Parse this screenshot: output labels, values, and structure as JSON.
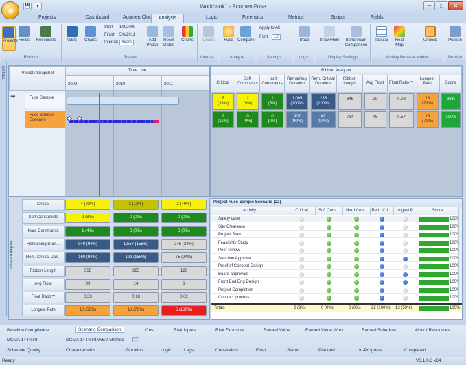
{
  "window": {
    "title": "Workbook1 - Acumen Fuse",
    "min": "─",
    "max": "□",
    "close": "✕"
  },
  "qat": [
    "💾",
    "▾"
  ],
  "tabs": [
    "Projects",
    "Dashboard",
    "Acumen Cloud™",
    "Analysis",
    "Logic",
    "Forensics",
    "Metrics",
    "Scripts",
    "Fields"
  ],
  "active_tab": "Analysis",
  "ribbon": {
    "groups": [
      "Ribbons",
      "Phases",
      "Interse...",
      "Analyze",
      "Settings",
      "Logic",
      "Display Settings",
      "Activity Browser Modes",
      "Publish"
    ],
    "buttons": {
      "projects": "Projects",
      "fields": "Fields",
      "resources": "Resources",
      "wbs": "WBS",
      "charts": "Charts",
      "add_phase": "Add Phase",
      "reset_dates": "Reset Dates",
      "charts2": "Charts",
      "charts3": "Charts",
      "fuse": "Fuse",
      "compare": "Compare",
      "trace": "Trace",
      "show_hide": "Show/Hide",
      "benchmark": "Benchmark Comparison",
      "tabular": "Tabular",
      "heat_map": "Heat Map",
      "undock": "Undock",
      "publish": "Publish"
    },
    "start_label": "Start",
    "start_value": "1/8/2009",
    "finish_label": "Finish",
    "finish_value": "5/6/2011",
    "interval_label": "Interval",
    "interval_value": "Years",
    "apply_all": "Apply to All",
    "font_label": "Font",
    "font_value": "12"
  },
  "side_label": "Metrics",
  "timeline": {
    "header_project": "Project / Snapshot",
    "header_timeline": "Time Line",
    "years": [
      "2009",
      "2010",
      "2011"
    ],
    "projects": [
      {
        "name": "Fuse Sample"
      },
      {
        "name": "Fuse Sample Scenario"
      }
    ]
  },
  "ribbon_analyzer": {
    "title": "Ribbon Analyzer",
    "columns": [
      "Critical",
      "Soft Constraints",
      "Hard Constraints",
      "Remaining Duration",
      "Rem. Critical Duration",
      "Ribbon Length",
      "Avg Float",
      "Float Ratio™",
      "Longest Path",
      "Score"
    ],
    "rows": [
      [
        "6\n(33%)",
        "2\n(9%)",
        "1\n(5%)",
        "1,005\n(100%)",
        "235\n(100%)",
        "848",
        "29",
        "0.08",
        "13\n(72%)",
        "86%"
      ],
      [
        "2\n(11%)",
        "0\n(0%)",
        "0\n(0%)",
        "907\n(90%)",
        "49\n(90%)",
        "714",
        "48",
        "0.57",
        "13\n(72%)",
        "100%"
      ]
    ]
  },
  "phase_analyzer": {
    "label": "Phase Analyzer",
    "rows": [
      {
        "name": "Critical",
        "values": [
          "4 (22%)",
          "3 (13%)",
          "2 (40%)"
        ]
      },
      {
        "name": "Soft Constraints",
        "values": [
          "2 (8%)",
          "0 (0%)",
          "0 (0%)"
        ]
      },
      {
        "name": "Hard Constraints",
        "values": [
          "1 (4%)",
          "0 (0%)",
          "0 (0%)"
        ]
      },
      {
        "name": "Remaining Durs...",
        "values": [
          "940 (94%)",
          "1,557 (155%)",
          "245 (24%)"
        ]
      },
      {
        "name": "Rem. Critical Dur...",
        "values": [
          "160 (94%)",
          "129 (155%)",
          "75 (24%)"
        ]
      },
      {
        "name": "Ribbon Length",
        "values": [
          "358",
          "365",
          "126"
        ]
      },
      {
        "name": "Avg Float",
        "values": [
          "99",
          "14",
          "1"
        ]
      },
      {
        "name": "Float Ratio™",
        "values": [
          "0.33",
          "0.18",
          "0.02"
        ]
      },
      {
        "name": "Longest Path",
        "values": [
          "10 (56%)",
          "18 (78%)",
          "5 (100%)"
        ]
      }
    ]
  },
  "project_panel": {
    "title": "Project Fuse Sample Scenario (22)",
    "columns": [
      "Activity",
      "Critical",
      "Soft Cons...",
      "Hard Con...",
      "Rem. Crit...",
      "Longest P...",
      "Score"
    ],
    "rows": [
      "Safety case",
      "Site Clearance",
      "Project Start",
      "Feasibility Study",
      "Peer review",
      "Sanction Approval",
      "Proof of Concept Design",
      "Board approvals",
      "Front End Eng Design",
      "Project Completion",
      "Contract process"
    ],
    "row_score": "100%",
    "totals": {
      "label": "Totals",
      "critical": "2 (9%)",
      "soft": "0 (0%)",
      "hard": "0 (0%)",
      "rem": "22 (100%)",
      "longest": "13 (59%)",
      "score": "100%"
    }
  },
  "bottom_tabs": {
    "row1": [
      "Baseline Compliance",
      "Scenario Comparison",
      "Cost",
      "Risk Inputs",
      "Risk Exposure",
      "Earned Value",
      "Earned Value Work",
      "Earned Schedule",
      "Work / Resources"
    ],
    "row2": [
      "DCMA 14 Point",
      "DCMA 14 Point w/EV Method"
    ],
    "row3": [
      "Schedule Quality",
      "Characteristics",
      "Duration",
      "Logic",
      "Lags",
      "Constraints",
      "Float",
      "Status",
      "Planned",
      "In-Progress",
      "Completed"
    ]
  },
  "status": {
    "left": "Ready",
    "right": "V3.1.0.3 x64"
  }
}
